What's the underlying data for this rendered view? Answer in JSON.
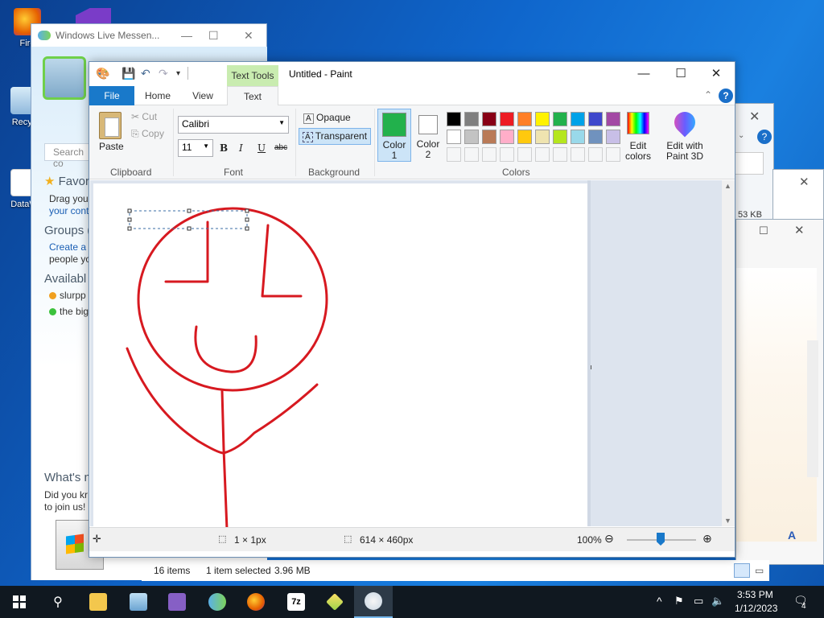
{
  "desktop": {
    "icons": [
      {
        "label": "Fire",
        "color": "#e66000"
      },
      {
        "label": "Recyc",
        "color": "#9bc3e6"
      },
      {
        "label": "DataW",
        "color": "#ffffff"
      }
    ]
  },
  "messenger": {
    "title": "Windows Live Messen...",
    "search_placeholder": "Search co",
    "favorites_heading": "Favor",
    "drag_text": "Drag you",
    "contacts_link": "your cont",
    "groups_heading": "Groups (",
    "create_group_link": "Create a g",
    "people_text": "people yo",
    "available_heading": "Availabl",
    "contacts": [
      {
        "name": "slurpp",
        "status_color": "#f0a020"
      },
      {
        "name": "the big",
        "status_color": "#3cc23c"
      }
    ],
    "whats_new_heading": "What's n",
    "did_you_know": "Did you kr",
    "join_text": "to join us!"
  },
  "paint": {
    "context_tab": "Text Tools",
    "title": "Untitled - Paint",
    "tabs": {
      "file": "File",
      "home": "Home",
      "view": "View",
      "text": "Text"
    },
    "clipboard": {
      "paste": "Paste",
      "cut": "Cut",
      "copy": "Copy",
      "label": "Clipboard"
    },
    "font": {
      "family": "Calibri",
      "size": "11",
      "bold": "B",
      "italic": "I",
      "underline": "U",
      "strike": "abc",
      "label": "Font"
    },
    "background": {
      "opaque": "Opaque",
      "transparent": "Transparent",
      "label": "Background"
    },
    "colors": {
      "color1_label": "Color",
      "color1_num": "1",
      "color2_label": "Color",
      "color2_num": "2",
      "color1": "#22b14c",
      "color2": "#ffffff",
      "edit_colors": "Edit colors",
      "paint3d": "Edit with Paint 3D",
      "label": "Colors",
      "palette_row1": [
        "#000000",
        "#7f7f7f",
        "#880015",
        "#ed1c24",
        "#ff7f27",
        "#fff200",
        "#22b14c",
        "#00a2e8",
        "#3f48cc",
        "#a349a4"
      ],
      "palette_row2": [
        "#ffffff",
        "#c3c3c3",
        "#b97a57",
        "#ffaec9",
        "#ffc90e",
        "#efe4b0",
        "#b5e61d",
        "#99d9ea",
        "#7092be",
        "#c8bfe7"
      ]
    },
    "status": {
      "selection": "1 × 1px",
      "image_size": "614 × 460px",
      "zoom": "100%"
    }
  },
  "explorer_status": {
    "items": "16 items",
    "selected": "1 item selected",
    "size": "3.96 MB"
  },
  "background_window": {
    "size_text": "53 KB"
  },
  "taskbar": {
    "time": "3:53 PM",
    "date": "1/12/2023",
    "notification_count": "4",
    "apps": [
      "file-explorer",
      "control-panel",
      "visual-studio",
      "messenger",
      "firefox",
      "7zip",
      "tool",
      "paint"
    ]
  }
}
